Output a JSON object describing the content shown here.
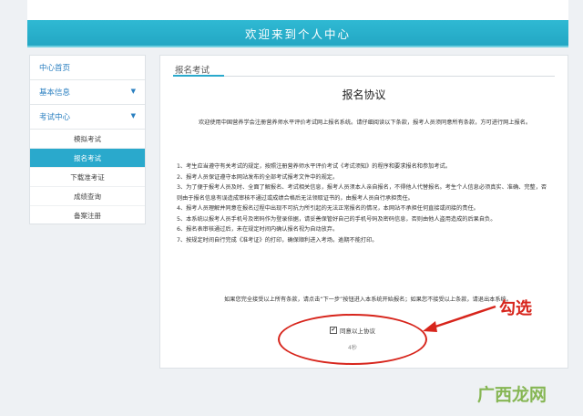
{
  "header": {
    "title": "欢迎来到个人中心"
  },
  "sidebar": {
    "items": [
      {
        "label": "中心首页",
        "arrow": ""
      },
      {
        "label": "基本信息",
        "arrow": "▼"
      },
      {
        "label": "考试中心",
        "arrow": "▼"
      }
    ],
    "sub_items": [
      "模拟考试",
      "报名考试",
      "下载准考证",
      "成绩查询",
      "备案注册"
    ],
    "active_sub": "报名考试"
  },
  "main": {
    "tab": "报名考试",
    "title": "报名协议",
    "intro": "欢迎使用中国营养学会注册营养师水平评价考试网上报名系统。请仔细阅读以下条款，报考人员须同意所有条款，方可进行网上报名。",
    "terms": [
      "1、考生应当遵守有关考试的规定，按照注册营养师水平评价考试《考试须知》的程序和要求报名和参加考试。",
      "2、报考人员保证遵守本网站发布的全部考试报考文件中的规定。",
      "3、为了便于报考人员及时、全面了解报名、考试相关信息，报考人员须本人亲自报名，不得他人代替报名。考生个人信息必须真实、准确、完整，否则由于报名信息有误造成审核不通过或成绩合格后无法领取证书的，由报考人员自行承担责任。",
      "4、报考人员理解并同意在报名过程中出现不可抗力所引起的无法正常报名的情况，本网站不承担任何直接或间接的责任。",
      "5、本系统以报考人员手机号及密码作为登录依据，请妥善保管好自己的手机号码及密码信息，否则由他人盗用造成的后果自负。",
      "6、报名表审核通过后，未在规定时间内确认报名视为自动放弃。",
      "7、按规定时间自行完成《准考证》的打印，确保顺利进入考场。逾期不能打印。"
    ],
    "closing": "如果您完全接受以上所有条款，请点击“下一步”按钮进入本系统开始报名；如果您不接受以上条款，请退出本系统。",
    "agree_label": "同意以上协议",
    "countdown": "4秒"
  },
  "annotation": {
    "text": "勾选",
    "color": "#d7251c"
  },
  "watermark": {
    "text": "广西龙网"
  },
  "colors": {
    "accent": "#2aa9cc",
    "header": "#2fb9d3",
    "link": "#2a7fc0"
  }
}
